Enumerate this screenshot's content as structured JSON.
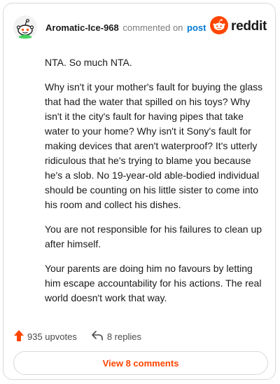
{
  "header": {
    "username": "Aromatic-Ice-968",
    "action_text": "commented on",
    "post_link": "post",
    "brand": "reddit"
  },
  "comment": {
    "paragraphs": [
      "NTA. So much NTA.",
      "Why isn't it your mother's fault for buying the glass that had the water that spilled on his toys? Why isn't it the city's fault for having pipes that take water to your home? Why isn't it Sony's fault for making devices that aren't waterproof? It's utterly ridiculous that he's trying to blame you because he's a slob. No 19-year-old able-bodied individual should be counting on his little sister to come into his room and collect his dishes.",
      "You are not responsible for his failures to clean up after himself.",
      "Your parents are doing him no favours by letting him escape accountability for his actions. The real world doesn't work that way."
    ]
  },
  "footer": {
    "upvotes": "935 upvotes",
    "replies": "8 replies",
    "view_button": "View 8 comments"
  },
  "colors": {
    "brand_orange": "#ff4500",
    "link_blue": "#0079d3",
    "muted_text": "#7c7c7c",
    "border": "#d9d9d9"
  },
  "icons": {
    "avatar": "snoo-avatar-icon",
    "brand": "reddit-logo-icon",
    "upvote": "upvote-arrow-icon",
    "reply": "reply-arrow-icon"
  }
}
